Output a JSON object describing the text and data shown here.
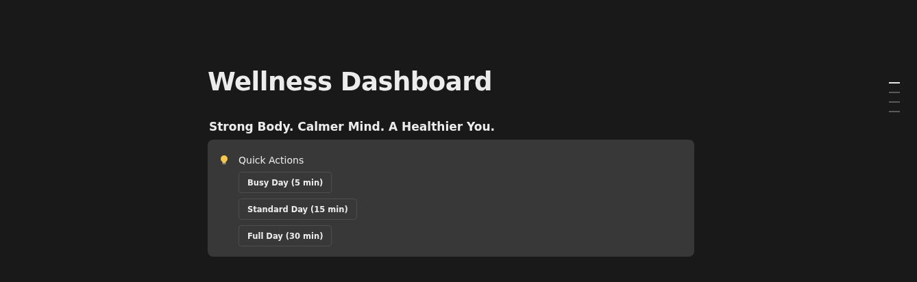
{
  "page": {
    "title": "Wellness Dashboard",
    "subtitle": "Strong Body. Calmer Mind. A Healthier You."
  },
  "callout": {
    "title": "Quick Actions",
    "buttons": [
      "Busy Day (5 min)",
      "Standard Day (15 min)",
      "Full Day (30 min)"
    ]
  },
  "outline_marks": [
    {
      "selected": true
    },
    {
      "selected": false
    },
    {
      "selected": false
    },
    {
      "selected": false
    }
  ]
}
